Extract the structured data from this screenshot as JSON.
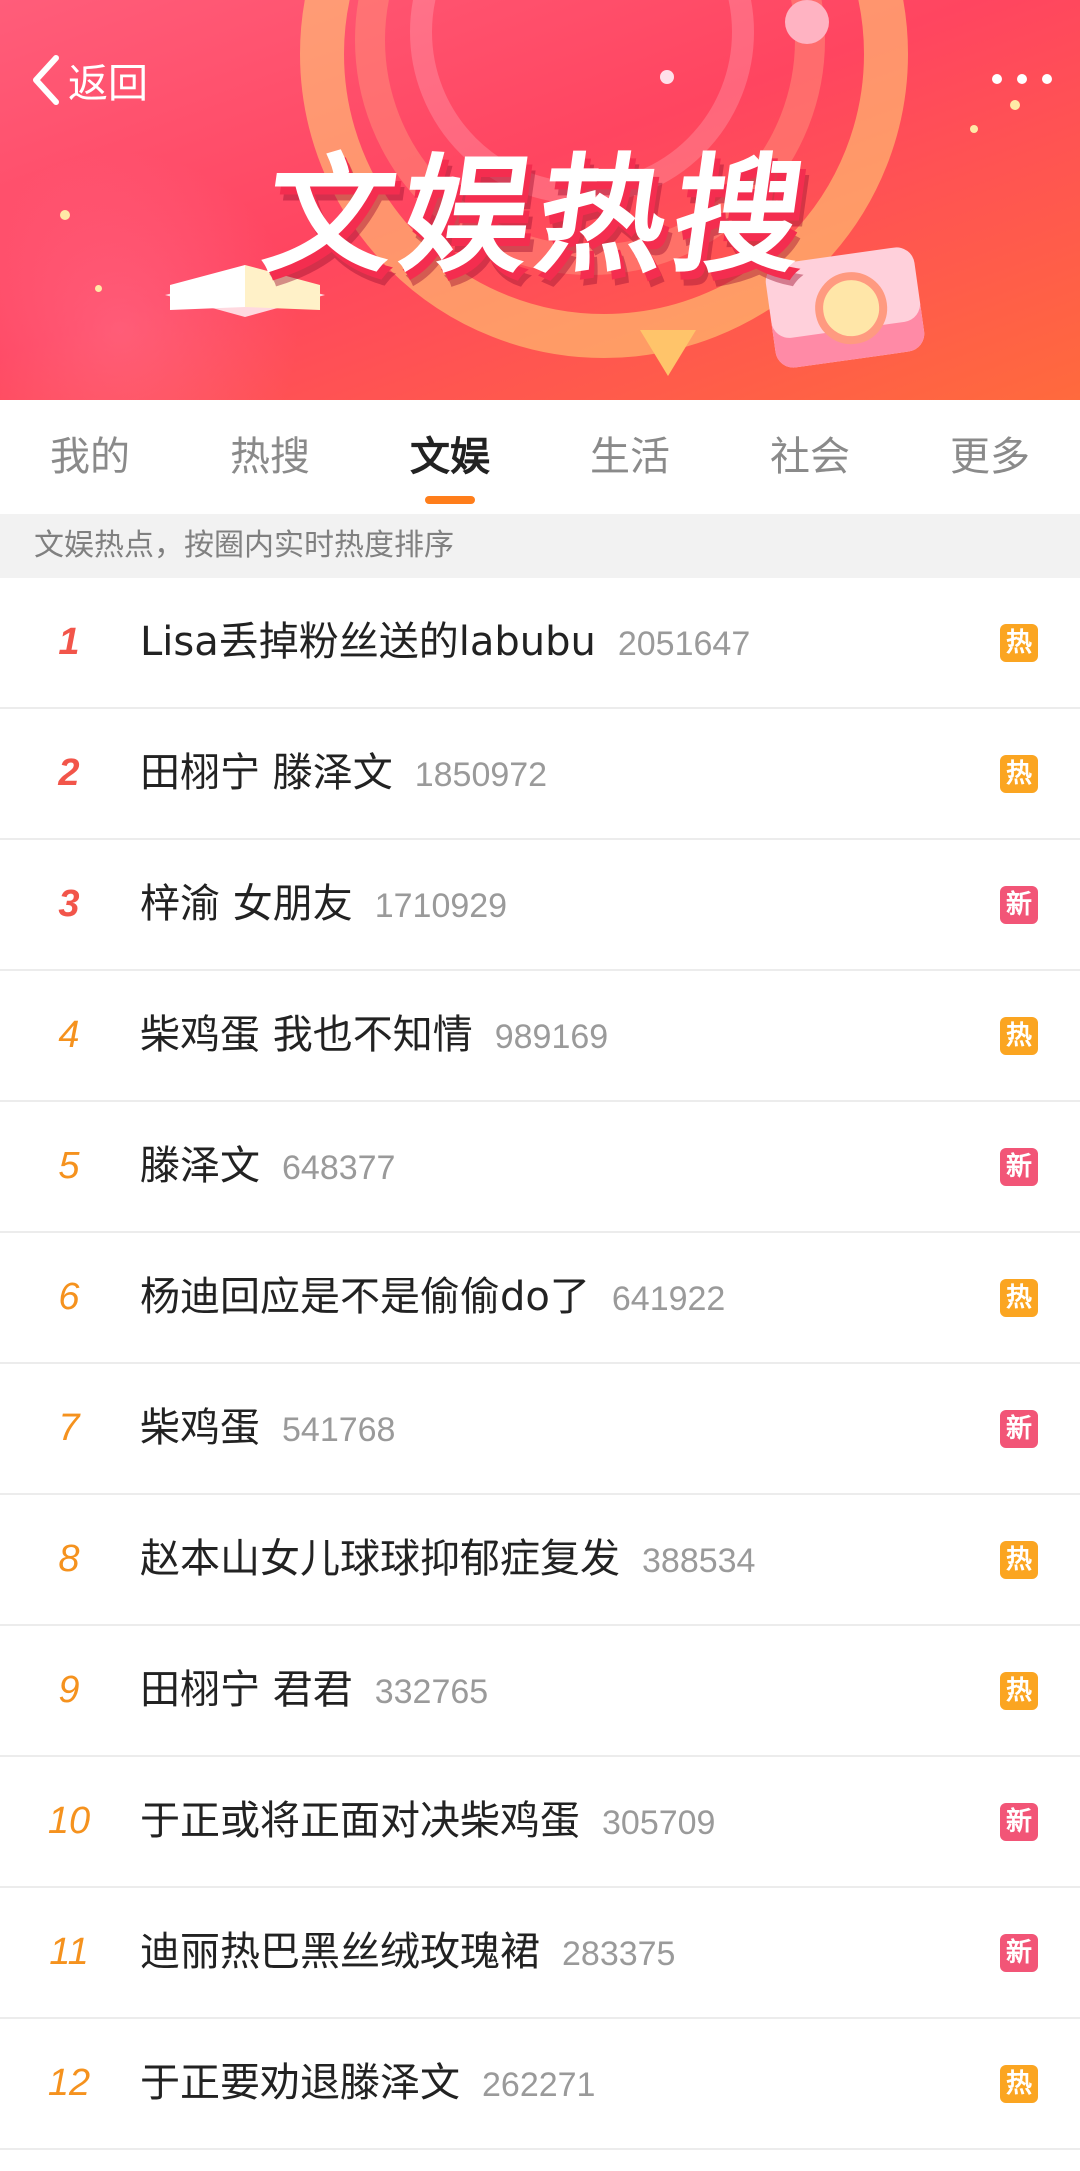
{
  "header": {
    "back_label": "返回",
    "banner_title": "文娱热搜"
  },
  "tabs": [
    {
      "label": "我的"
    },
    {
      "label": "热搜"
    },
    {
      "label": "文娱",
      "active": true
    },
    {
      "label": "生活"
    },
    {
      "label": "社会"
    },
    {
      "label": "更多"
    }
  ],
  "subtitle": "文娱热点，按圈内实时热度排序",
  "colors": {
    "accent": "#ff7e1b",
    "rank_top": "#f2554a",
    "rank_other": "#f5921e",
    "badge_hot": "#fba521",
    "badge_new": "#f25577"
  },
  "list": [
    {
      "rank": "1",
      "topic": "Lisa丢掉粉丝送的labubu",
      "heat": "2051647",
      "badge": "热"
    },
    {
      "rank": "2",
      "topic": "田栩宁 滕泽文",
      "heat": "1850972",
      "badge": "热"
    },
    {
      "rank": "3",
      "topic": "梓渝 女朋友",
      "heat": "1710929",
      "badge": "新"
    },
    {
      "rank": "4",
      "topic": "柴鸡蛋 我也不知情",
      "heat": "989169",
      "badge": "热"
    },
    {
      "rank": "5",
      "topic": "滕泽文",
      "heat": "648377",
      "badge": "新"
    },
    {
      "rank": "6",
      "topic": "杨迪回应是不是偷偷do了",
      "heat": "641922",
      "badge": "热"
    },
    {
      "rank": "7",
      "topic": "柴鸡蛋",
      "heat": "541768",
      "badge": "新"
    },
    {
      "rank": "8",
      "topic": "赵本山女儿球球抑郁症复发",
      "heat": "388534",
      "badge": "热"
    },
    {
      "rank": "9",
      "topic": "田栩宁 君君",
      "heat": "332765",
      "badge": "热"
    },
    {
      "rank": "10",
      "topic": "于正或将正面对决柴鸡蛋",
      "heat": "305709",
      "badge": "新"
    },
    {
      "rank": "11",
      "topic": "迪丽热巴黑丝绒玫瑰裙",
      "heat": "283375",
      "badge": "新"
    },
    {
      "rank": "12",
      "topic": "于正要劝退滕泽文",
      "heat": "262271",
      "badge": "热"
    }
  ]
}
